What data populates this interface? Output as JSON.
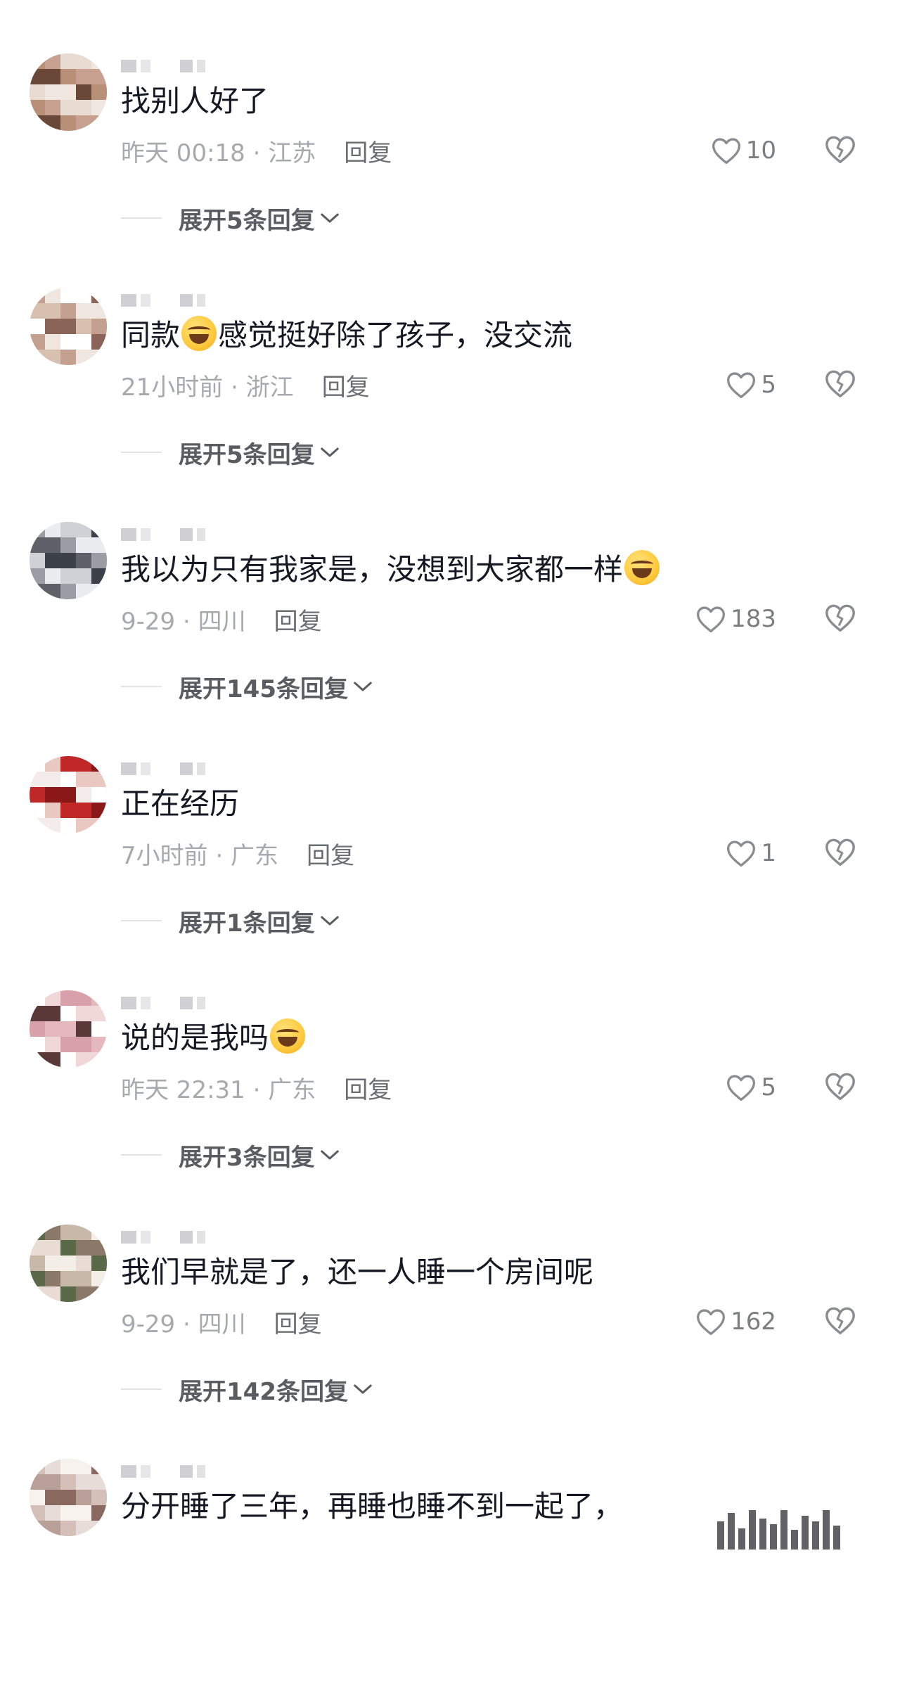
{
  "icons": {
    "like": "heart-outline-icon",
    "dislike": "broken-heart-icon",
    "expand": "chevron-down-icon"
  },
  "colors": {
    "text_primary": "#161823",
    "text_meta": "#a7a9ae",
    "reply": "#6b6d73",
    "expand": "#5a5c62"
  },
  "comments": [
    {
      "text_before": "找别人好了",
      "emoji": false,
      "text_after": "",
      "time_location": "昨天 00:18 · 江苏",
      "reply_label": "回复",
      "likes": "10",
      "expand_label": "展开5条回复",
      "avatar_palette": [
        "#b89078",
        "#e8dcd2",
        "#6a4838",
        "#c8a090",
        "#f0e8e0"
      ]
    },
    {
      "text_before": "同款",
      "emoji": true,
      "text_after": "感觉挺好除了孩子，没交流",
      "time_location": "21小时前 · 浙江",
      "reply_label": "回复",
      "likes": "5",
      "expand_label": "展开5条回复",
      "avatar_palette": [
        "#d8c0b0",
        "#f0e6e0",
        "#8a6458",
        "#c4a090",
        "#ffffff"
      ]
    },
    {
      "text_before": "我以为只有我家是，没想到大家都一样",
      "emoji": true,
      "text_after": "",
      "time_location": "9-29 · 四川",
      "reply_label": "回复",
      "likes": "183",
      "expand_label": "展开145条回复",
      "avatar_palette": [
        "#3c4048",
        "#9a9ea4",
        "#ced2d6",
        "#5e6268",
        "#eaecef"
      ]
    },
    {
      "text_before": "正在经历",
      "emoji": false,
      "text_after": "",
      "time_location": "7小时前 · 广东",
      "reply_label": "回复",
      "likes": "1",
      "expand_label": "展开1条回复",
      "avatar_palette": [
        "#c02828",
        "#f4ecea",
        "#e8c8c0",
        "#8a1818",
        "#ffffff"
      ]
    },
    {
      "text_before": "说的是我吗",
      "emoji": true,
      "text_after": "",
      "time_location": "昨天 22:31 · 广东",
      "reply_label": "回复",
      "likes": "5",
      "expand_label": "展开3条回复",
      "avatar_palette": [
        "#f0d8d8",
        "#e4b8bc",
        "#ffffff",
        "#d8a0a8",
        "#5a3838"
      ]
    },
    {
      "text_before": "我们早就是了，还一人睡一个房间呢",
      "emoji": false,
      "text_after": "",
      "time_location": "9-29 · 四川",
      "reply_label": "回复",
      "likes": "162",
      "expand_label": "展开142条回复",
      "avatar_palette": [
        "#5a6a48",
        "#c8b8a8",
        "#e8dcd4",
        "#8a7868",
        "#f4eee8"
      ]
    },
    {
      "text_before": "分开睡了三年，再睡也睡不到一起了，",
      "emoji": false,
      "text_after": "",
      "time_location": "",
      "reply_label": "",
      "likes": "",
      "expand_label": "",
      "avatar_palette": [
        "#b8a098",
        "#e8dcd8",
        "#8a6a60",
        "#d4c0b8",
        "#f8f2ee"
      ]
    }
  ]
}
